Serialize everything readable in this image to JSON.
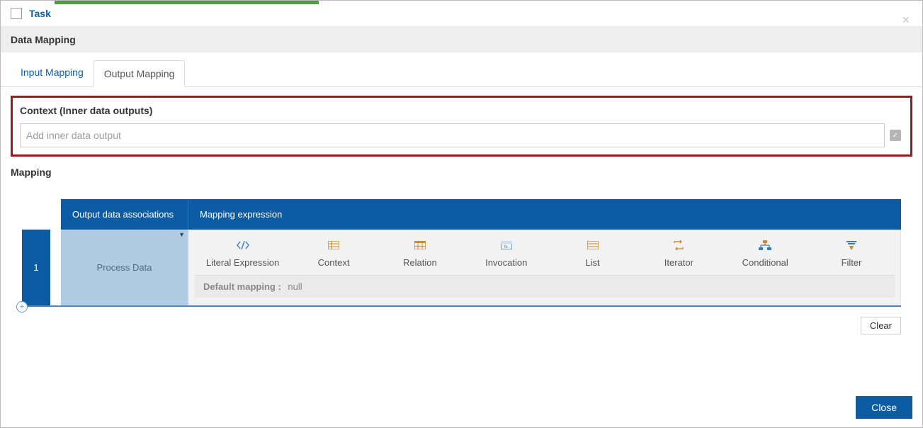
{
  "header": {
    "task_label": "Task",
    "section_title": "Data Mapping"
  },
  "tabs": {
    "input": "Input Mapping",
    "output": "Output Mapping"
  },
  "context": {
    "label": "Context (Inner data outputs)",
    "placeholder": "Add inner data output"
  },
  "mapping": {
    "label": "Mapping",
    "col_assoc": "Output data associations",
    "col_expr": "Mapping expression",
    "row_number": "1",
    "assoc_cell": "Process Data",
    "default_label": "Default mapping :",
    "default_value": "null",
    "options": [
      "Literal Expression",
      "Context",
      "Relation",
      "Invocation",
      "List",
      "Iterator",
      "Conditional",
      "Filter"
    ]
  },
  "buttons": {
    "clear": "Clear",
    "close": "Close"
  }
}
